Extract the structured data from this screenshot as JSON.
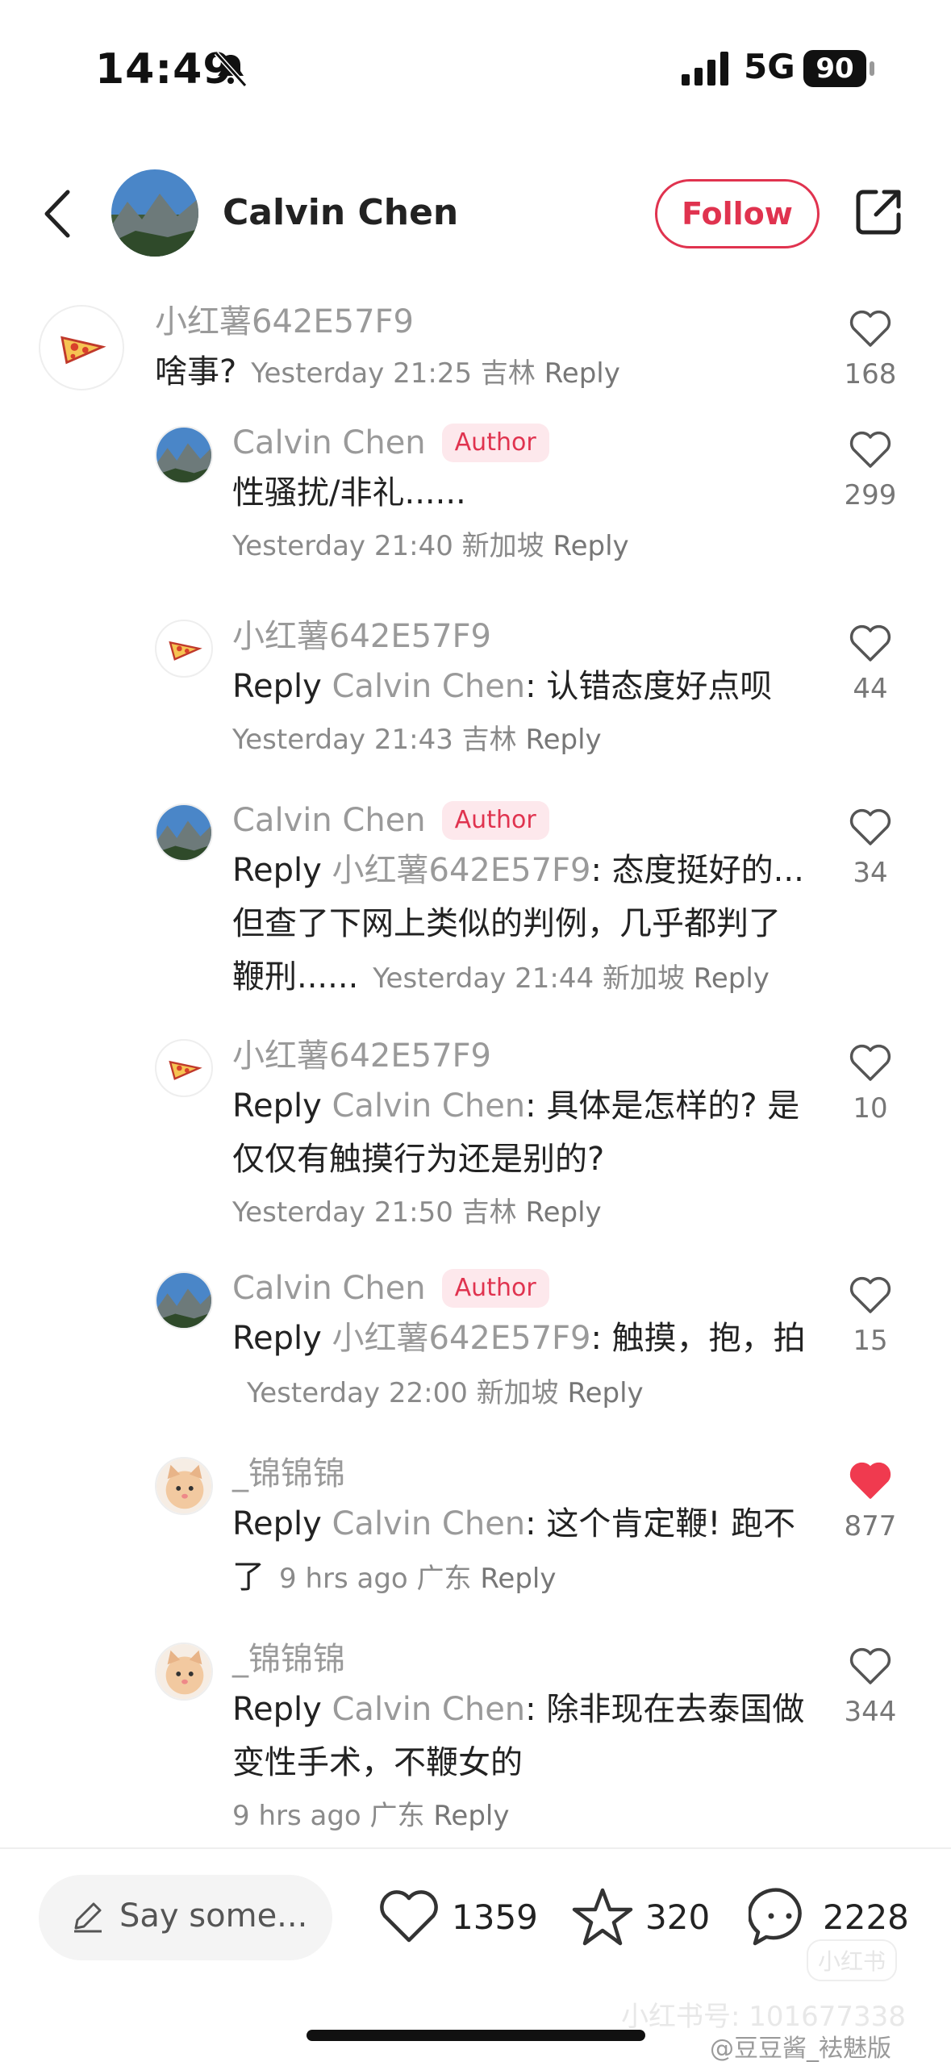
{
  "status_bar": {
    "time": "14:49",
    "network": "5G",
    "battery": "90"
  },
  "header": {
    "name": "Calvin Chen",
    "follow_label": "Follow"
  },
  "author_tag": "Author",
  "comments": [
    {
      "user": "小红薯642E57F9",
      "text": "啥事?",
      "time": "Yesterday 21:25 吉林",
      "reply": "Reply",
      "likes": "168"
    },
    {
      "user": "Calvin Chen",
      "text": "性骚扰/非礼......",
      "time": "Yesterday 21:40 新加坡",
      "reply": "Reply",
      "likes": "299"
    },
    {
      "user": "小红薯642E57F9",
      "prefix": "Reply",
      "target": "Calvin Chen",
      "text": ": 认错态度好点呗",
      "time": "Yesterday 21:43 吉林",
      "reply": "Reply",
      "likes": "44"
    },
    {
      "user": "Calvin Chen",
      "prefix": "Reply",
      "target": "小红薯642E57F9",
      "text": ": 态度挺好的...但查了下网上类似的判例，几乎都判了鞭刑......",
      "time": "Yesterday 21:44 新加坡",
      "reply": "Reply",
      "likes": "34"
    },
    {
      "user": "小红薯642E57F9",
      "prefix": "Reply",
      "target": "Calvin Chen",
      "text": ": 具体是怎样的? 是仅仅有触摸行为还是别的?",
      "time": "Yesterday 21:50 吉林",
      "reply": "Reply",
      "likes": "10"
    },
    {
      "user": "Calvin Chen",
      "prefix": "Reply",
      "target": "小红薯642E57F9",
      "text": ": 触摸，抱，拍",
      "time": "Yesterday 22:00 新加坡",
      "reply": "Reply",
      "likes": "15"
    },
    {
      "user": "_锦锦锦",
      "prefix": "Reply",
      "target": "Calvin Chen",
      "text": ": 这个肯定鞭! 跑不了",
      "time": "9 hrs ago 广东",
      "reply": "Reply",
      "likes": "877"
    },
    {
      "user": "_锦锦锦",
      "prefix": "Reply",
      "target": "Calvin Chen",
      "text": ": 除非现在去泰国做变性手术，不鞭女的",
      "time": "9 hrs ago 广东",
      "reply": "Reply",
      "likes": "344"
    }
  ],
  "bottom_bar": {
    "placeholder": "Say some...",
    "likes": "1359",
    "stars": "320",
    "comments": "2228"
  },
  "watermarks": {
    "logo": "小红书",
    "id": "小红书号: 101677338",
    "weibo": "@豆豆酱_袪魅版"
  },
  "colors": {
    "accent": "#e0334f",
    "liked": "#f03a4f",
    "muted_text": "#9a9a9a"
  }
}
